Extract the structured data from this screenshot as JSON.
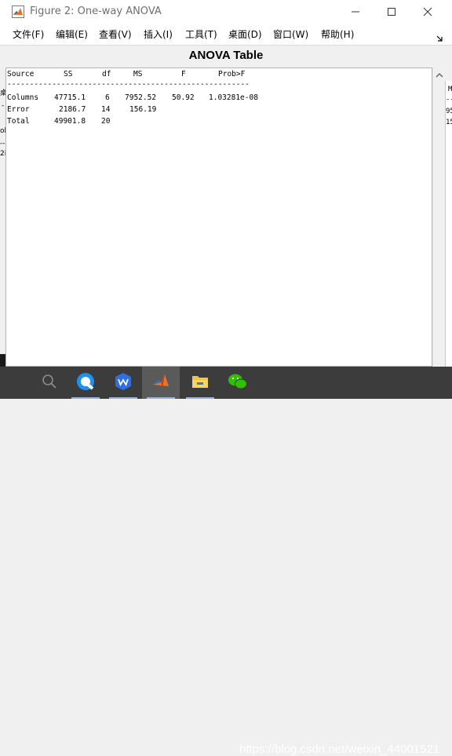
{
  "window": {
    "title": "Figure 2: One-way ANOVA"
  },
  "menu": {
    "items": [
      "文件(F)",
      "编辑(E)",
      "查看(V)",
      "插入(I)",
      "工具(T)",
      "桌面(D)",
      "窗口(W)",
      "帮助(H)"
    ]
  },
  "table": {
    "title": "ANOVA Table",
    "headers": {
      "source": "Source",
      "ss": "SS",
      "df": "df",
      "ms": "MS",
      "f": "F",
      "prob": "Prob>F"
    },
    "divider": "------------------------------------------------------",
    "rows": [
      {
        "source": "Columns",
        "ss": "47715.1",
        "df": "6",
        "ms": "7952.52",
        "f": "50.92",
        "prob": "1.03281e-08"
      },
      {
        "source": "Error",
        "ss": "2186.7",
        "df": "14",
        "ms": "156.19",
        "f": "",
        "prob": ""
      },
      {
        "source": "Total",
        "ss": "49901.8",
        "df": "20",
        "ms": "",
        "f": "",
        "prob": ""
      }
    ]
  },
  "background_peek": {
    "left": [
      "桌",
      "-",
      "ol",
      "--",
      "2i"
    ],
    "right": [
      "M",
      "--",
      "95",
      "15"
    ]
  },
  "taskbar": {
    "watermark": "https://blog.csdn.net/weixin_44001521",
    "pinned": [
      "search-icon",
      "browser-icon",
      "wps-icon",
      "matlab-icon",
      "file-explorer-icon",
      "wechat-icon"
    ]
  },
  "colors": {
    "taskbar": "#3c3c3c",
    "title_text": "#6e6e6e",
    "content_bg": "#ffffff"
  }
}
